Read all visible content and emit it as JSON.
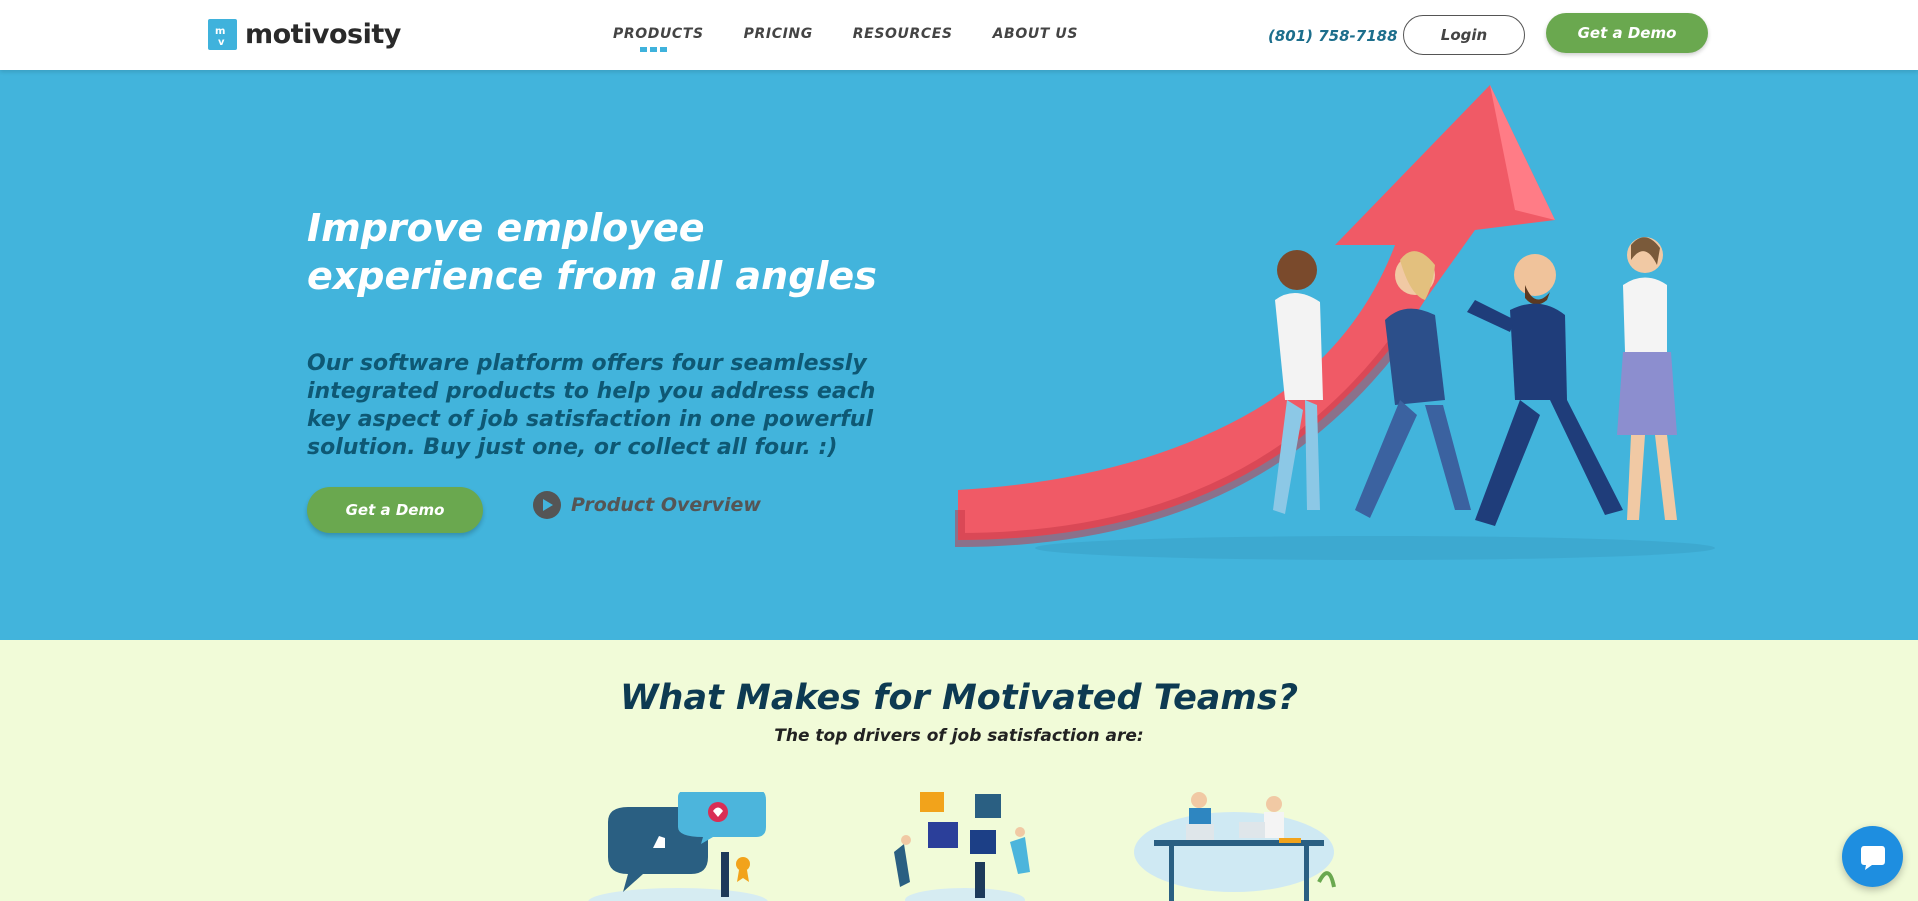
{
  "header": {
    "logo_text": "motivosity",
    "nav": [
      {
        "label": "PRODUCTS",
        "active": true
      },
      {
        "label": "PRICING"
      },
      {
        "label": "RESOURCES"
      },
      {
        "label": "ABOUT US"
      }
    ],
    "phone": "(801) 758-7188",
    "login_label": "Login",
    "demo_label": "Get a Demo"
  },
  "hero": {
    "title": "Improve employee experience from all angles",
    "subtitle": "Our software platform offers four seamlessly integrated products to help you address each key aspect of job satisfaction in one powerful solution. Buy just one, or collect all four. :)",
    "demo_label": "Get a Demo",
    "overview_label": "Product Overview"
  },
  "section2": {
    "title": "What Makes for Motivated Teams?",
    "subtitle": "The top drivers of job satisfaction are:"
  },
  "colors": {
    "brand_blue": "#42b4dc",
    "green": "#6aa84f",
    "arrow_red": "#f05a66",
    "section_bg": "#f1fbd8",
    "title_navy": "#0d3a52"
  },
  "icons": [
    "logo-mark-icon",
    "play-icon",
    "chat-icon"
  ]
}
